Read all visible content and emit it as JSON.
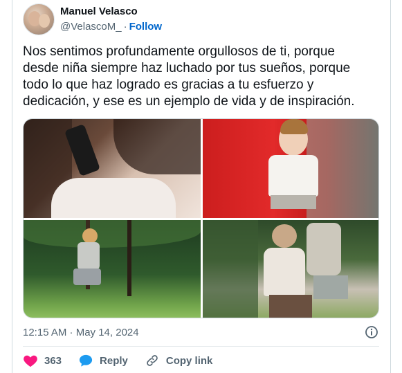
{
  "author": {
    "name": "Manuel Velasco",
    "handle": "@VelascoM_",
    "separator": "·",
    "follow_label": "Follow"
  },
  "tweet": {
    "lines": [
      "Nos sentimos profundamente orgullosos de ti, porque",
      "desde niña siempre haz luchado por tus sueños, porque",
      "todo lo que haz logrado es gracias a tu esfuerzo y",
      "dedicación, y ese es un ejemplo de vida y de inspiración."
    ]
  },
  "meta": {
    "timestamp": "12:15 AM · May 14, 2024"
  },
  "actions": {
    "like_count": "363",
    "reply_label": "Reply",
    "copy_link_label": "Copy link"
  },
  "colors": {
    "like": "#f91880",
    "reply": "#1d9bf0",
    "follow": "#0066cc",
    "text": "#0f1419",
    "secondary": "#536471"
  },
  "icons": [
    "heart-icon",
    "reply-bubble-icon",
    "link-icon",
    "info-icon"
  ]
}
